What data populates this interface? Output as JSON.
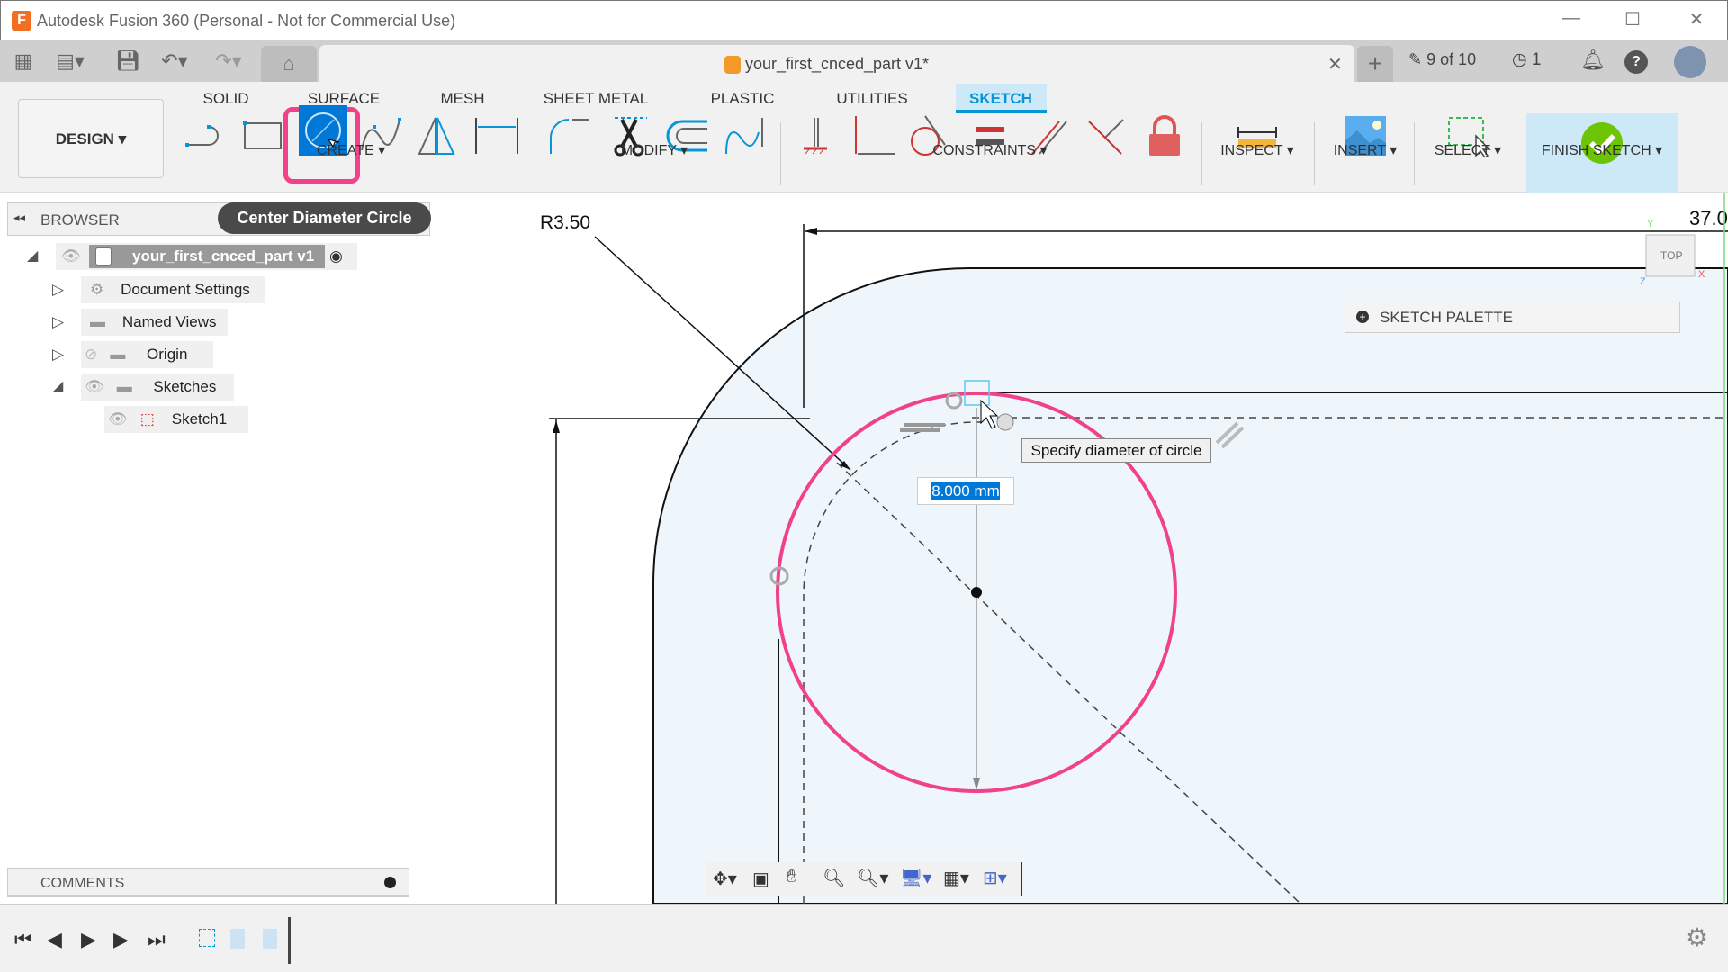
{
  "window": {
    "title": "Autodesk Fusion 360 (Personal - Not for Commercial Use)",
    "minimize": "—",
    "maximize": "☐",
    "close": "✕"
  },
  "tabbar": {
    "doc_title": "your_first_cnced_part v1*",
    "close": "✕",
    "jobs": "9 of 10",
    "clock_count": "1"
  },
  "ribbon": {
    "workspace": "DESIGN ▾",
    "tabs": [
      "SOLID",
      "SURFACE",
      "MESH",
      "SHEET METAL",
      "PLASTIC",
      "UTILITIES",
      "SKETCH"
    ],
    "active_tab": "SKETCH",
    "groups": {
      "create": "CREATE ▾",
      "modify": "MODIFY ▾",
      "constraints": "CONSTRAINTS ▾",
      "inspect": "INSPECT ▾",
      "insert": "INSERT ▾",
      "select": "SELECT ▾",
      "finish": "FINISH SKETCH ▾"
    },
    "tool_tooltip": "Center Diameter Circle",
    "accent": "#0696d7",
    "highlight": "#f0418a"
  },
  "browser": {
    "title": "BROWSER",
    "root": "your_first_cnced_part v1",
    "items": [
      "Document Settings",
      "Named Views",
      "Origin",
      "Sketches",
      "Sketch1"
    ]
  },
  "canvas": {
    "radius_dim": "R3.50",
    "width_dim": "37.0",
    "sketch_palette": "SKETCH PALETTE",
    "diameter_value": "8.000 mm",
    "hint": "Specify diameter of circle",
    "viewcube": "TOP",
    "axis_y": "Y",
    "axis_z": "Z",
    "axis_x": "X",
    "circle_color": "#f0418a",
    "part_fill": "#eef6fc"
  },
  "comments": {
    "title": "COMMENTS"
  }
}
